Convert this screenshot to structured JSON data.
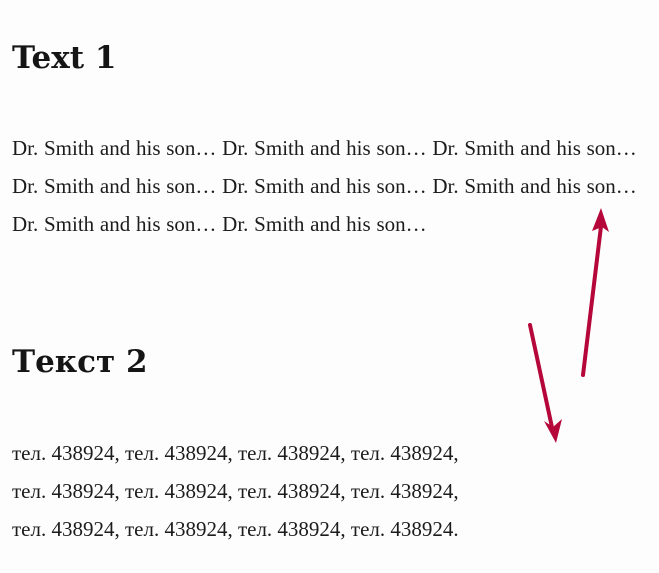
{
  "section1": {
    "heading": "Text 1",
    "paragraph": "Dr. Smith and his son… Dr. Smith and his son… Dr. Smith and his son… Dr. Smith and his son… Dr. Smith and his son… Dr. Smith and his son… Dr. Smith and his son… Dr. Smith and his son…"
  },
  "section2": {
    "heading": "Текст 2",
    "lines": [
      "тел. 438924, тел. 438924, тел. 438924, тел. 438924,",
      "тел. 438924, тел. 438924, тел. 438924, тел. 438924,",
      "тел. 438924, тел. 438924, тел. 438924, тел. 438924."
    ]
  },
  "annotations": {
    "arrow_color": "#b5073a"
  }
}
